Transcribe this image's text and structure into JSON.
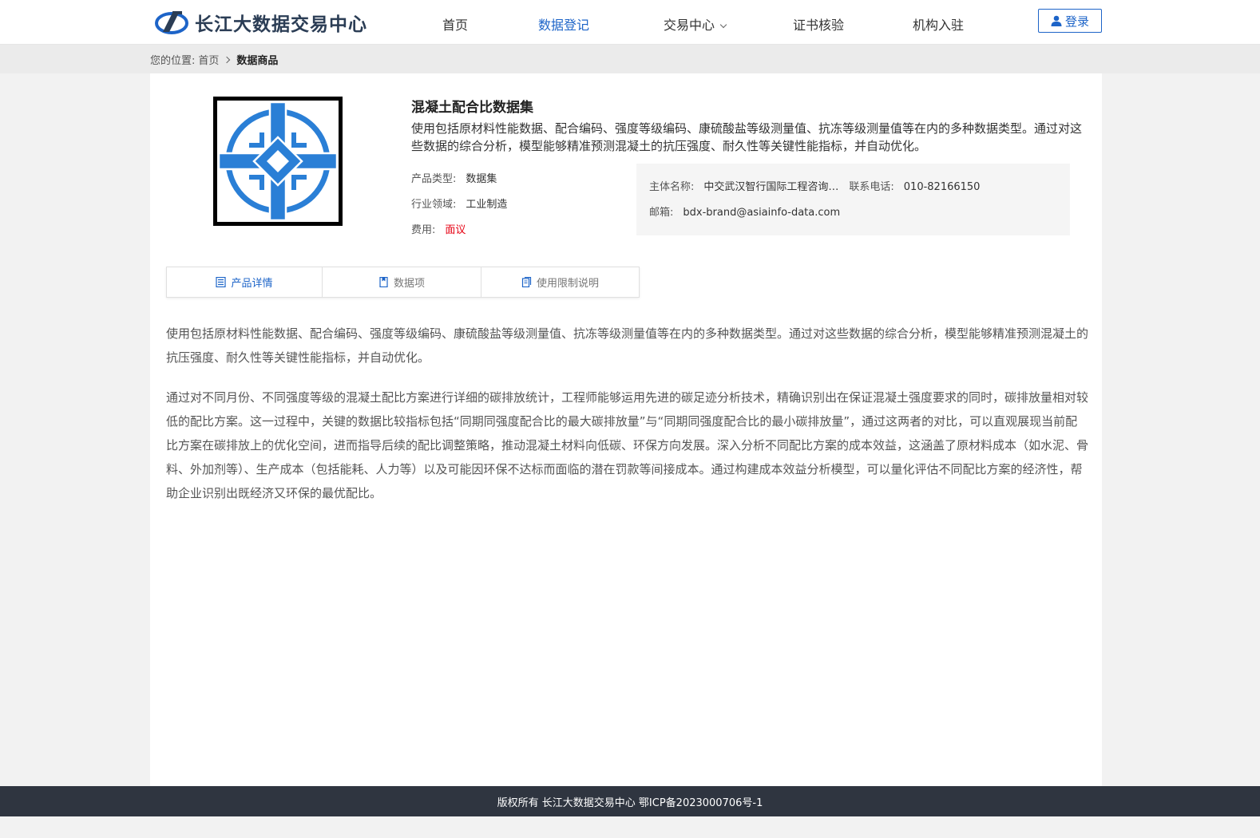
{
  "header": {
    "logo_text": "长江大数据交易中心",
    "nav": [
      {
        "label": "首页",
        "active": false
      },
      {
        "label": "数据登记",
        "active": true
      },
      {
        "label": "交易中心",
        "active": false
      },
      {
        "label": "证书核验",
        "active": false
      },
      {
        "label": "机构入驻",
        "active": false
      }
    ],
    "login_label": "登录"
  },
  "breadcrumb": {
    "prefix": "您的位置:",
    "home": "首页",
    "current": "数据商品"
  },
  "product": {
    "title": "混凝土配合比数据集",
    "summary": "使用包括原材料性能数据、配合编码、强度等级编码、康硫酸盐等级测量值、抗冻等级测量值等在内的多种数据类型。通过对这些数据的综合分析，模型能够精准预测混凝土的抗压强度、耐久性等关键性能指标，并自动优化。",
    "type_label": "产品类型:",
    "type_value": "数据集",
    "domain_label": "行业领域:",
    "domain_value": "工业制造",
    "fee_label": "费用:",
    "fee_value": "面议",
    "fee_color": "#e60012"
  },
  "contact": {
    "org_label": "主体名称:",
    "org_value": "中交武汉智行国际工程咨询有限公司",
    "phone_label": "联系电话:",
    "phone_value": "010-82166150",
    "email_label": "邮箱:",
    "email_value": "bdx-brand@asiainfo-data.com"
  },
  "tabs": [
    {
      "label": "产品详情",
      "icon": "list-icon",
      "active": true
    },
    {
      "label": "数据项",
      "icon": "bookmark-icon",
      "active": false
    },
    {
      "label": "使用限制说明",
      "icon": "document-icon",
      "active": false
    }
  ],
  "detail": {
    "p1": "使用包括原材料性能数据、配合编码、强度等级编码、康硫酸盐等级测量值、抗冻等级测量值等在内的多种数据类型。通过对这些数据的综合分析，模型能够精准预测混凝土的抗压强度、耐久性等关键性能指标，并自动优化。",
    "p2": "通过对不同月份、不同强度等级的混凝土配比方案进行详细的碳排放统计，工程师能够运用先进的碳足迹分析技术，精确识别出在保证混凝土强度要求的同时，碳排放量相对较低的配比方案。这一过程中，关键的数据比较指标包括“同期同强度配合比的最大碳排放量”与“同期同强度配合比的最小碳排放量”，通过这两者的对比，可以直观展现当前配比方案在碳排放上的优化空间，进而指导后续的配比调整策略，推动混凝土材料向低碳、环保方向发展。深入分析不同配比方案的成本效益，这涵盖了原材料成本（如水泥、骨料、外加剂等）、生产成本（包括能耗、人力等）以及可能因环保不达标而面临的潜在罚款等间接成本。通过构建成本效益分析模型，可以量化评估不同配比方案的经济性，帮助企业识别出既经济又环保的最优配比。"
  },
  "footer": {
    "text": "版权所有 长江大数据交易中心 鄂ICP备2023000706号-1"
  },
  "colors": {
    "accent": "#1d64c8",
    "footer_bg": "#2f3540",
    "price_red": "#e60012"
  }
}
